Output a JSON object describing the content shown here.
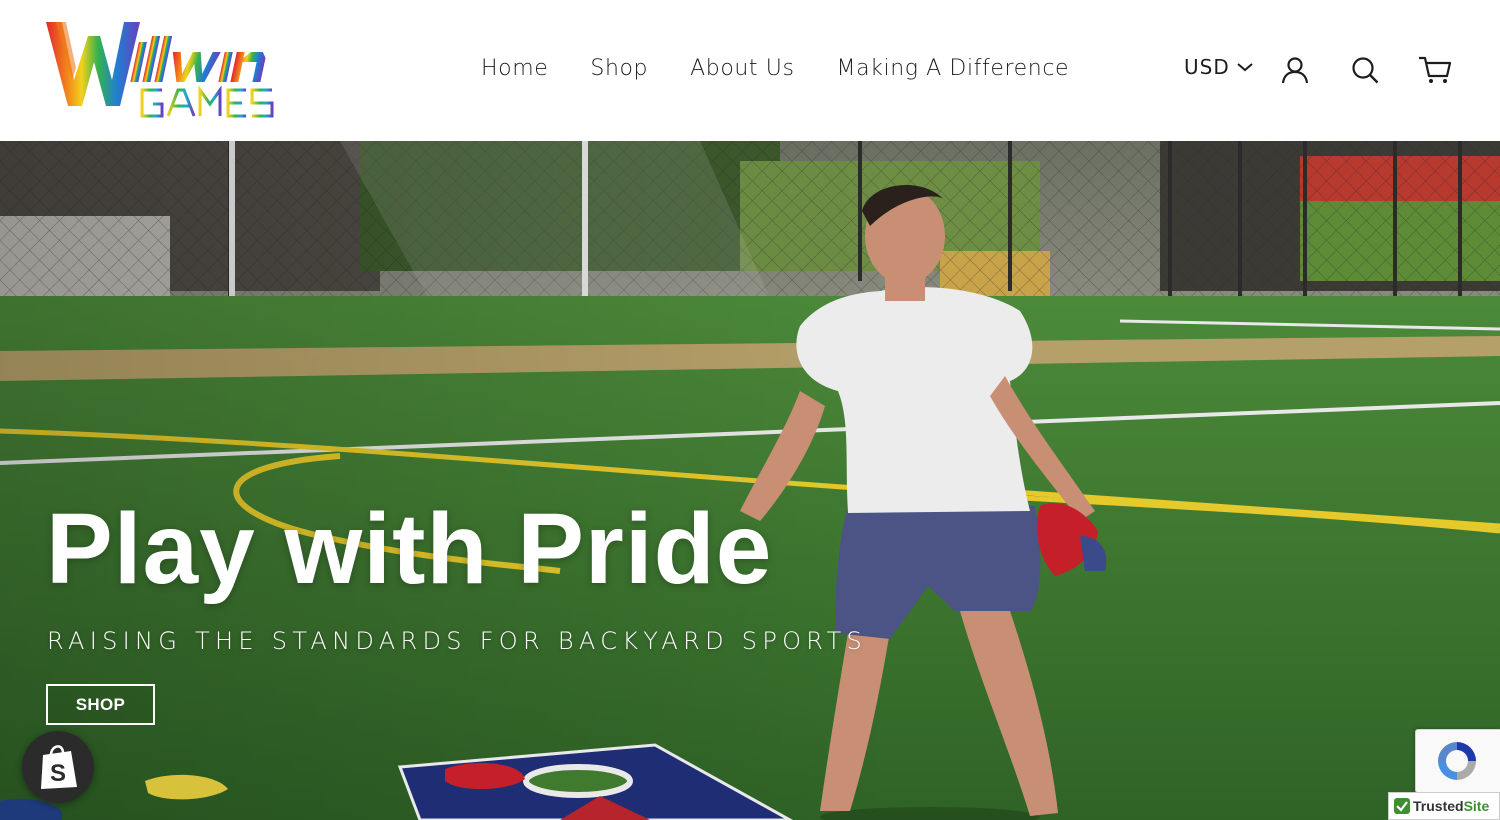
{
  "brand": {
    "logo_top": "Willwin",
    "logo_bottom": "GAMES"
  },
  "nav": {
    "items": [
      {
        "label": "Home"
      },
      {
        "label": "Shop"
      },
      {
        "label": "About Us"
      },
      {
        "label": "Making A Difference"
      }
    ]
  },
  "header": {
    "currency": "USD",
    "icons": [
      "account-icon",
      "search-icon",
      "cart-icon"
    ]
  },
  "hero": {
    "title": "Play with Pride",
    "subtitle": "RAISING THE STANDARDS FOR BACKYARD SPORTS",
    "button_label": "SHOP"
  },
  "badges": {
    "trusted_prefix": "Trusted",
    "trusted_suffix": "Site"
  },
  "colors": {
    "field_green": "#3f7a2e",
    "accent_red": "#d11f2a",
    "board_navy": "#1c2a6b",
    "text_dark": "#1c1d1d"
  }
}
